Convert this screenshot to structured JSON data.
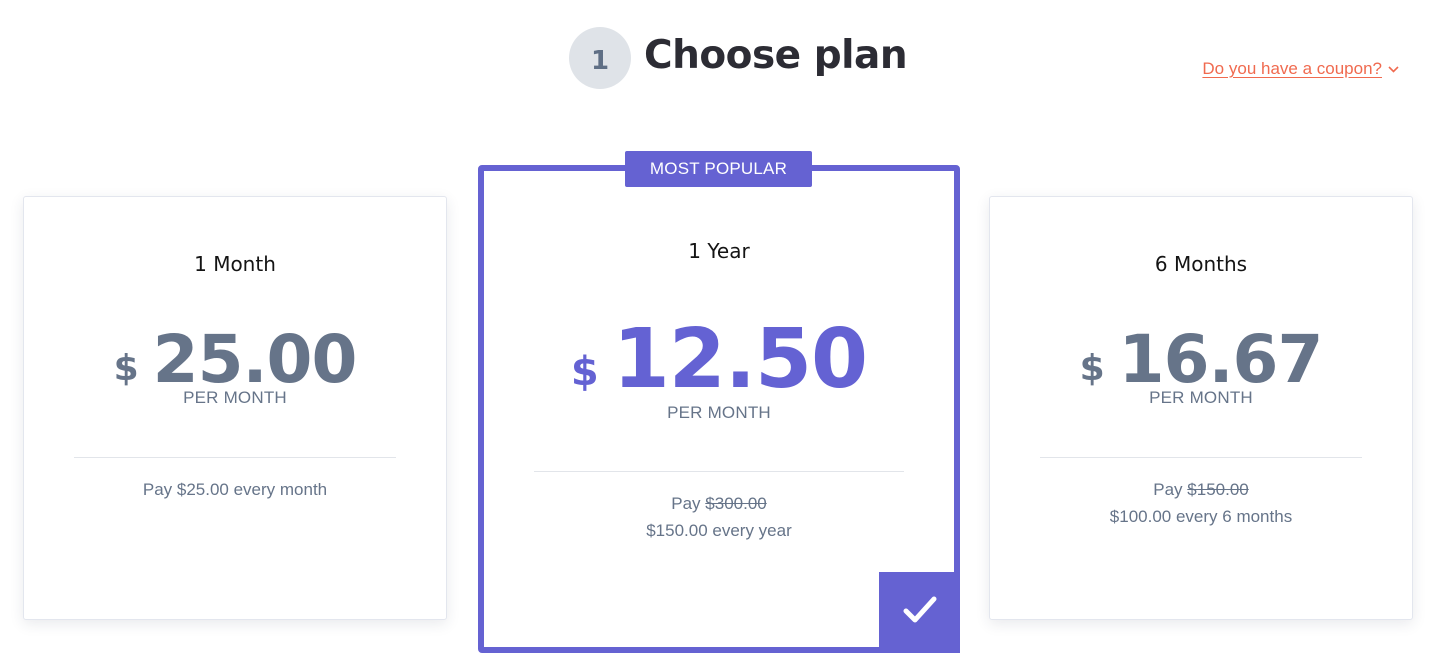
{
  "header": {
    "step_number": "1",
    "title": "Choose plan",
    "coupon_link": "Do you have a coupon?"
  },
  "plans": [
    {
      "name": "1 Month",
      "currency": "$",
      "price": "25.00",
      "period": "PER MONTH",
      "pay_line": "Pay $25.00 every month",
      "selected": false
    },
    {
      "badge": "MOST POPULAR",
      "name": "1 Year",
      "currency": "$",
      "price": "12.50",
      "period": "PER MONTH",
      "pay_prefix": "Pay ",
      "original_price": "$300.00",
      "pay_line2": "$150.00 every year",
      "selected": true
    },
    {
      "name": "6 Months",
      "currency": "$",
      "price": "16.67",
      "period": "PER MONTH",
      "pay_prefix": "Pay ",
      "original_price": "$150.00",
      "pay_line2": "$100.00 every 6 months",
      "selected": false
    }
  ],
  "colors": {
    "accent": "#6562d2",
    "coupon": "#f06a4f",
    "muted_text": "#667489",
    "title_text": "#2c2c34"
  },
  "icons": {
    "coupon_toggle": "chevron-down-icon",
    "selected_marker": "checkmark-icon"
  }
}
